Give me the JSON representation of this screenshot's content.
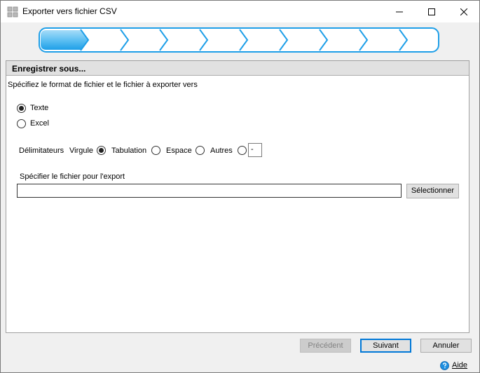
{
  "window": {
    "title": "Exporter vers fichier CSV",
    "icons": {
      "app": "app-grid-icon",
      "minimize": "minimize-icon",
      "maximize": "maximize-icon",
      "close": "close-icon"
    }
  },
  "wizard": {
    "total_steps": 9,
    "current_step": 1,
    "accent": "#1e9fe8"
  },
  "section": {
    "title": "Enregistrer sous..."
  },
  "description": "Spécifiez le format de fichier et le fichier à exporter vers",
  "format": {
    "options": [
      {
        "label": "Texte",
        "checked": true
      },
      {
        "label": "Excel",
        "checked": false
      }
    ]
  },
  "delimiters": {
    "label": "Délimitateurs",
    "options": [
      {
        "label": "Virgule",
        "checked": true
      },
      {
        "label": "Tabulation",
        "checked": false
      },
      {
        "label": "Espace",
        "checked": false
      },
      {
        "label": "Autres",
        "checked": false
      }
    ],
    "other_value": "-"
  },
  "file": {
    "label": "Spécifier le fichier pour l'export",
    "value": "",
    "select_button": "Sélectionner"
  },
  "footer": {
    "prev": "Précédent",
    "next": "Suivant",
    "cancel": "Annuler",
    "help": "Aide",
    "help_icon": "help-icon"
  }
}
